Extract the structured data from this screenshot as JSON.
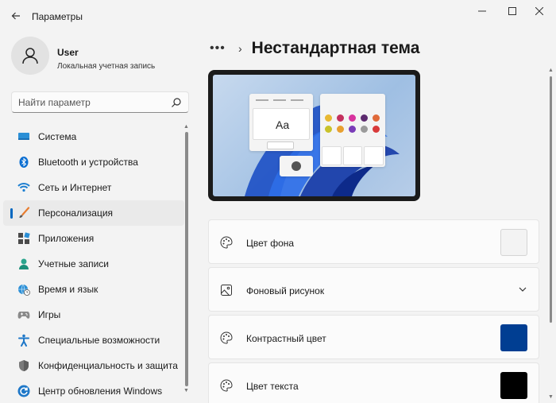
{
  "window": {
    "title": "Параметры",
    "controls": {
      "minimize": "—",
      "maximize": "☐",
      "close": "✕"
    }
  },
  "user": {
    "name": "User",
    "account_type": "Локальная учетная запись"
  },
  "search": {
    "placeholder": "Найти параметр"
  },
  "sidebar": {
    "items": [
      {
        "label": "Система",
        "icon": "monitor-icon"
      },
      {
        "label": "Bluetooth и устройства",
        "icon": "bluetooth-icon"
      },
      {
        "label": "Сеть и Интернет",
        "icon": "wifi-icon"
      },
      {
        "label": "Персонализация",
        "icon": "brush-icon",
        "active": true
      },
      {
        "label": "Приложения",
        "icon": "apps-icon"
      },
      {
        "label": "Учетные записи",
        "icon": "person-icon"
      },
      {
        "label": "Время и язык",
        "icon": "globe-clock-icon"
      },
      {
        "label": "Игры",
        "icon": "gamepad-icon"
      },
      {
        "label": "Специальные возможности",
        "icon": "accessibility-icon"
      },
      {
        "label": "Конфиденциальность и защита",
        "icon": "shield-icon"
      },
      {
        "label": "Центр обновления Windows",
        "icon": "update-icon"
      }
    ]
  },
  "breadcrumb": {
    "more": "•••",
    "separator": "›",
    "title": "Нестандартная тема"
  },
  "preview": {
    "sample_text": "Aa",
    "palette": [
      "#e8b832",
      "#c4305e",
      "#d8339e",
      "#5c2a6e",
      "#e06a3a",
      "#c9c22a",
      "#e8a030",
      "#7a3cb8",
      "#9a9a9a",
      "#d83a3a"
    ]
  },
  "settings": [
    {
      "label": "Цвет фона",
      "icon": "palette-icon",
      "swatch": "#f3f3f3"
    },
    {
      "label": "Фоновый рисунок",
      "icon": "image-icon",
      "expandable": true
    },
    {
      "label": "Контрастный цвет",
      "icon": "palette-icon",
      "swatch": "#003e92"
    },
    {
      "label": "Цвет текста",
      "icon": "palette-icon",
      "swatch": "#000000"
    }
  ],
  "colors": {
    "accent": "#0067c0",
    "window_bg": "#f3f3f3",
    "card_bg": "#fbfbfb"
  }
}
